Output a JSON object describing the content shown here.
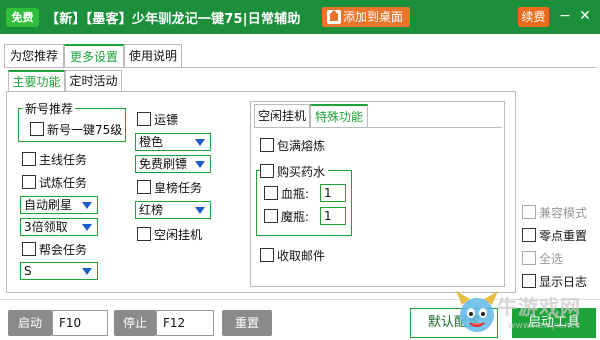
{
  "titlebar": {
    "free_badge": "免费",
    "title": "【新】【墨客】少年驯龙记一键75|日常辅助",
    "add_desktop": "添加到桌面",
    "renew": "续费",
    "minimize": "−",
    "close": "✕"
  },
  "tabs": [
    {
      "label": "为您推荐"
    },
    {
      "label": "更多设置"
    },
    {
      "label": "使用说明"
    }
  ],
  "subtabs": [
    {
      "label": "主要功能"
    },
    {
      "label": "定时活动"
    }
  ],
  "main": {
    "new_account_group": "新号推荐",
    "one_key_75": "新号一键75级",
    "main_quest": "主线任务",
    "trial_quest": "试炼任务",
    "auto_refresh": "自动刷星",
    "triple_claim": "3倍领取",
    "guild_quest": "帮会任务",
    "s_select": "S",
    "escort": "运镖",
    "orange_select": "橙色",
    "free_refresh": "免费刷镖",
    "ranking_quest": "皇榜任务",
    "red_select": "红榜",
    "idle_hang": "空闲挂机"
  },
  "right_panel": {
    "tabs": [
      {
        "label": "空闲挂机"
      },
      {
        "label": "特殊功能"
      }
    ],
    "bag_full_smelt": "包满熔炼",
    "buy_potions_group": "购买药水",
    "hp_bottle_label": "血瓶:",
    "hp_bottle_qty": "1",
    "mp_bottle_label": "魔瓶:",
    "mp_bottle_qty": "1",
    "collect_mail": "收取邮件"
  },
  "side_options": {
    "compat_mode": "兼容模式",
    "zero_reset": "零点重置",
    "select_all": "全选",
    "show_log": "显示日志"
  },
  "bottom": {
    "start": "启动",
    "start_key": "F10",
    "stop": "停止",
    "stop_key": "F12",
    "reset": "重置",
    "default_config": "默认配置",
    "start_tool": "启动工具"
  },
  "watermark": {
    "text": "牛游戏网",
    "url": "www.newyx.net"
  },
  "colors": {
    "title_bar": "#1b8f3a",
    "accent_green": "#1ea33a",
    "orange": "#e8752a",
    "select_arrow": "#1a5ec8"
  }
}
